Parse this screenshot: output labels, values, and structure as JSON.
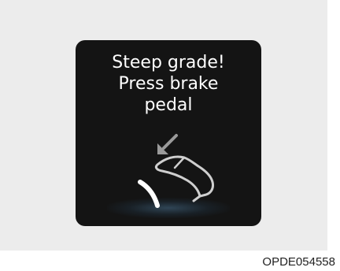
{
  "display": {
    "line1": "Steep grade!",
    "line2": "Press brake",
    "line3": "pedal",
    "icons": [
      "down-arrow-icon",
      "brake-foot-icon",
      "brake-pedal-icon"
    ]
  },
  "caption": "OPDE054558",
  "colors": {
    "background": "#ececec",
    "display": "#141414",
    "text": "#ffffff",
    "icon": "#bdbdbd"
  }
}
